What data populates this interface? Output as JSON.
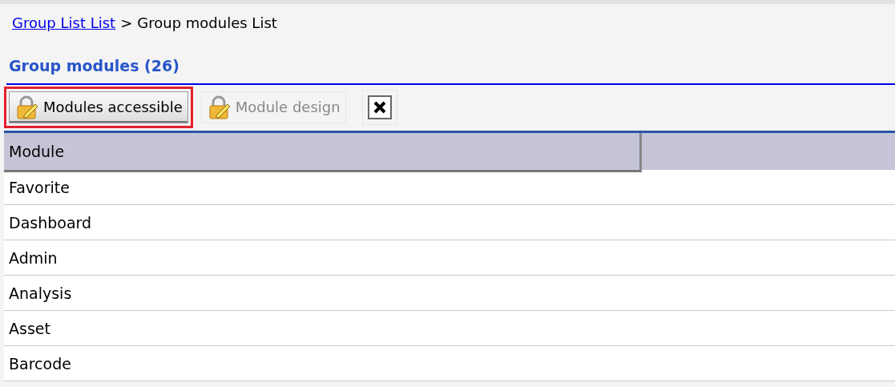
{
  "breadcrumb": {
    "link": "Group List List",
    "separator": ">",
    "current": "Group modules List"
  },
  "heading": "Group modules (26)",
  "toolbar": [
    {
      "kind": "button",
      "label": "Modules accessible",
      "disabled": false,
      "highlighted": true
    },
    {
      "kind": "button",
      "label": "Module design",
      "disabled": true,
      "highlighted": false
    },
    {
      "kind": "close",
      "highlighted": false
    }
  ],
  "table": {
    "columns": [
      "Module"
    ],
    "rows": [
      "Favorite",
      "Dashboard",
      "Admin",
      "Analysis",
      "Asset",
      "Barcode"
    ]
  }
}
